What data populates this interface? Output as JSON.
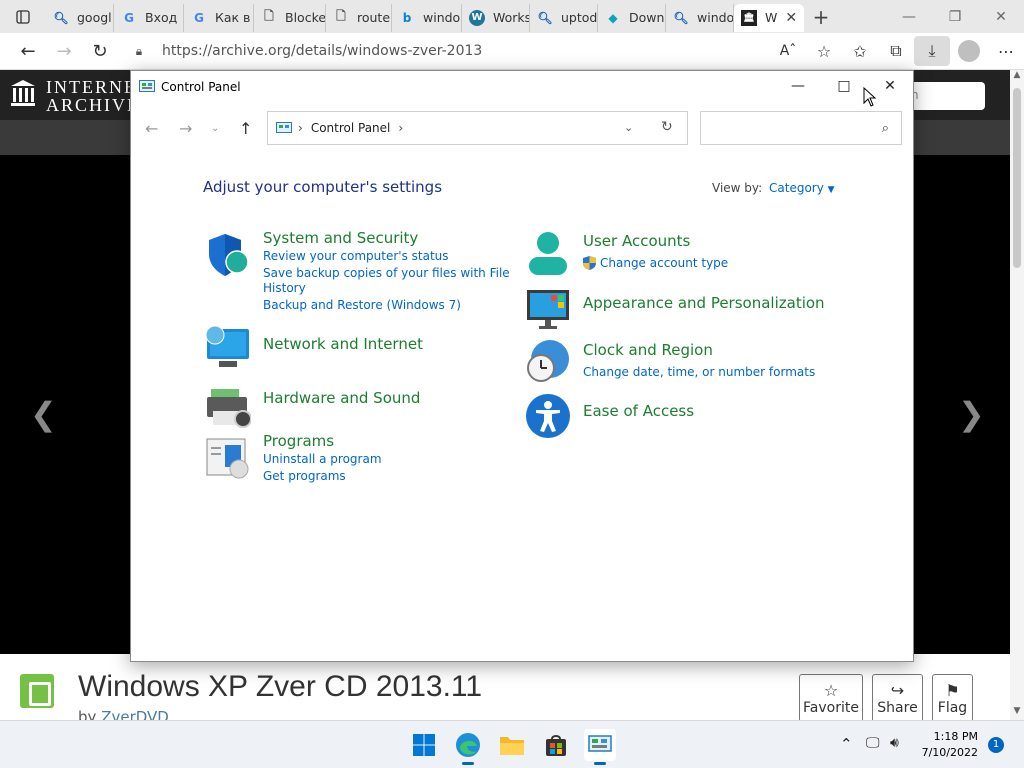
{
  "browser": {
    "tabs": [
      {
        "label": "googl",
        "icon": "search-favicon"
      },
      {
        "label": "Вход",
        "icon": "google-favicon"
      },
      {
        "label": "Как в",
        "icon": "google-favicon"
      },
      {
        "label": "Blocke",
        "icon": "page-favicon"
      },
      {
        "label": "router",
        "icon": "page-favicon"
      },
      {
        "label": "windo",
        "icon": "bing-favicon"
      },
      {
        "label": "Works",
        "icon": "wordpress-favicon"
      },
      {
        "label": "uptod",
        "icon": "search-favicon"
      },
      {
        "label": "Down",
        "icon": "diamond-favicon"
      },
      {
        "label": "windo",
        "icon": "search-favicon"
      },
      {
        "label": "W",
        "icon": "archive-favicon"
      }
    ],
    "address_url": "https://archive.org/details/windows-zver-2013"
  },
  "archive_page": {
    "logo_line1": "INTERNE",
    "logo_line2": "ARCHIVE",
    "search_placeholder": "h",
    "item_title": "Windows XP Zver CD 2013.11",
    "item_by_prefix": "by",
    "item_by_author": "ZverDVD",
    "buttons": {
      "favorite": "Favorite",
      "share": "Share",
      "flag": "Flag"
    }
  },
  "control_panel": {
    "window_title": "Control Panel",
    "breadcrumb": "Control Panel",
    "heading": "Adjust your computer's settings",
    "view_by_label": "View by:",
    "view_by_value": "Category",
    "categories": {
      "system_security": {
        "title": "System and Security",
        "links": [
          "Review your computer's status",
          "Save backup copies of your files with File",
          "History",
          "Backup and Restore (Windows 7)"
        ]
      },
      "network": {
        "title": "Network and Internet"
      },
      "hardware": {
        "title": "Hardware and Sound"
      },
      "programs": {
        "title": "Programs",
        "links": [
          "Uninstall a program",
          "Get programs"
        ]
      },
      "user_accounts": {
        "title": "User Accounts",
        "links": [
          "Change account type"
        ]
      },
      "appearance": {
        "title": "Appearance and Personalization"
      },
      "clock": {
        "title": "Clock and Region",
        "links": [
          "Change date, time, or number formats"
        ]
      },
      "ease": {
        "title": "Ease of Access"
      }
    }
  },
  "taskbar": {
    "time": "1:18 PM",
    "date": "7/10/2022",
    "notification_count": "1"
  },
  "colors": {
    "accent": "#0067c0",
    "link": "#0066cc",
    "category_title": "#1a7f2e",
    "heading": "#1e3287"
  }
}
